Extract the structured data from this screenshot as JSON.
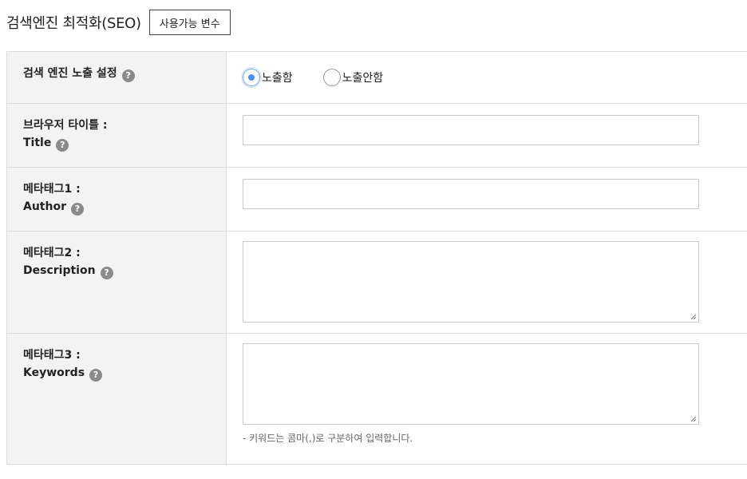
{
  "header": {
    "title": "검색엔진 최적화(SEO)",
    "vars_button": "사용가능 변수"
  },
  "rows": {
    "visibility": {
      "label": "검색 엔진 노출 설정",
      "options": [
        "노출함",
        "노출안함"
      ],
      "selected": "노출함"
    },
    "title": {
      "label_line1": "브라우저 타이틀 :",
      "label_line2": "Title",
      "value": ""
    },
    "author": {
      "label_line1": "메타태그1 :",
      "label_line2": "Author",
      "value": ""
    },
    "description": {
      "label_line1": "메타태그2 :",
      "label_line2": "Description",
      "value": ""
    },
    "keywords": {
      "label_line1": "메타태그3 :",
      "label_line2": "Keywords",
      "value": "",
      "hint": "- 키워드는 콤마(,)로 구분하여 입력합니다."
    }
  },
  "help_glyph": "?",
  "colors": {
    "accent": "#4a8ef0",
    "label_bg": "#f3f3f3",
    "border": "#dcdcdc"
  }
}
